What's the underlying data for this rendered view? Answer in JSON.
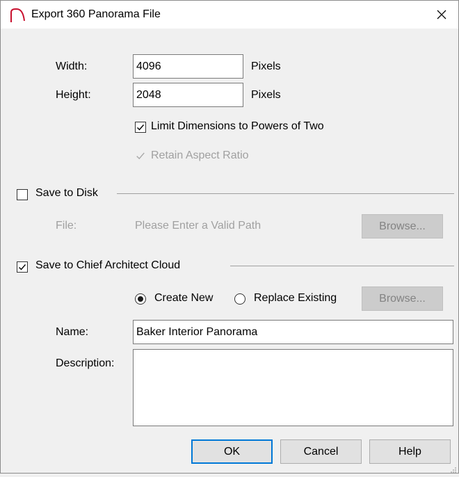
{
  "window": {
    "title": "Export 360 Panorama File",
    "icon": "chief-architect-logo-icon"
  },
  "dimensions": {
    "width_label": "Width:",
    "width_value": "4096",
    "width_unit": "Pixels",
    "height_label": "Height:",
    "height_value": "2048",
    "height_unit": "Pixels",
    "limit_label": "Limit Dimensions to Powers of Two",
    "limit_checked": true,
    "aspect_label": "Retain Aspect Ratio",
    "aspect_checked": true,
    "aspect_disabled": true
  },
  "save_disk": {
    "label": "Save to Disk",
    "checked": false,
    "file_label": "File:",
    "file_placeholder": "Please Enter a Valid Path",
    "browse_label": "Browse..."
  },
  "save_cloud": {
    "label": "Save to Chief Architect Cloud",
    "checked": true,
    "create_new_label": "Create New",
    "create_new_selected": true,
    "replace_label": "Replace Existing",
    "browse_label": "Browse...",
    "name_label": "Name:",
    "name_value": "Baker Interior Panorama",
    "description_label": "Description:",
    "description_value": ""
  },
  "buttons": {
    "ok": "OK",
    "cancel": "Cancel",
    "help": "Help"
  },
  "colors": {
    "focus_border": "#0078d7",
    "logo_red": "#c8102e"
  }
}
